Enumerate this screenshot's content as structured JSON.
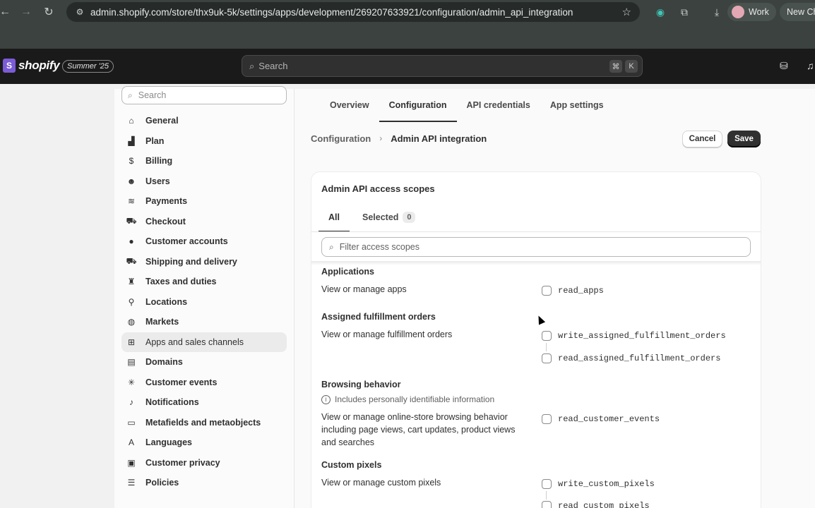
{
  "browser": {
    "url": "admin.shopify.com/store/thx9uk-5k/settings/apps/development/269207633921/configuration/admin_api_integration",
    "profile_label": "Work",
    "new_chrome_label": "New Ch"
  },
  "topbar": {
    "brand": "shopify",
    "badge": "Summer '25",
    "search_placeholder": "Search",
    "kbd_1": "⌘",
    "kbd_2": "K"
  },
  "sidebar": {
    "search_placeholder": "Search",
    "items": [
      {
        "label": "General",
        "icon": "store-icon"
      },
      {
        "label": "Plan",
        "icon": "plan-icon"
      },
      {
        "label": "Billing",
        "icon": "billing-icon"
      },
      {
        "label": "Users",
        "icon": "users-icon"
      },
      {
        "label": "Payments",
        "icon": "payments-icon"
      },
      {
        "label": "Checkout",
        "icon": "cart-icon"
      },
      {
        "label": "Customer accounts",
        "icon": "person-icon"
      },
      {
        "label": "Shipping and delivery",
        "icon": "truck-icon"
      },
      {
        "label": "Taxes and duties",
        "icon": "tax-icon"
      },
      {
        "label": "Locations",
        "icon": "location-icon"
      },
      {
        "label": "Markets",
        "icon": "globe-icon"
      },
      {
        "label": "Apps and sales channels",
        "icon": "apps-icon"
      },
      {
        "label": "Domains",
        "icon": "domains-icon"
      },
      {
        "label": "Customer events",
        "icon": "events-icon"
      },
      {
        "label": "Notifications",
        "icon": "bell-icon"
      },
      {
        "label": "Metafields and metaobjects",
        "icon": "metafields-icon"
      },
      {
        "label": "Languages",
        "icon": "languages-icon"
      },
      {
        "label": "Customer privacy",
        "icon": "lock-icon"
      },
      {
        "label": "Policies",
        "icon": "policies-icon"
      }
    ]
  },
  "tabs": [
    "Overview",
    "Configuration",
    "API credentials",
    "App settings"
  ],
  "breadcrumb": {
    "parent": "Configuration",
    "current": "Admin API integration"
  },
  "actions": {
    "cancel": "Cancel",
    "save": "Save"
  },
  "card": {
    "title": "Admin API access scopes",
    "tab_all": "All",
    "tab_selected": "Selected",
    "selected_count": "0",
    "filter_placeholder": "Filter access scopes"
  },
  "groups": [
    {
      "title": "Applications",
      "desc": "View or manage apps",
      "scopes": [
        "read_apps"
      ]
    },
    {
      "title": "Assigned fulfillment orders",
      "desc": "View or manage fulfillment orders",
      "scopes": [
        "write_assigned_fulfillment_orders",
        "read_assigned_fulfillment_orders"
      ]
    },
    {
      "title": "Browsing behavior",
      "note": "Includes personally identifiable information",
      "desc": "View or manage online-store browsing behavior including page views, cart updates, product views and searches",
      "scopes": [
        "read_customer_events"
      ]
    },
    {
      "title": "Custom pixels",
      "desc": "View or manage custom pixels",
      "scopes": [
        "write_custom_pixels",
        "read_custom_pixels"
      ]
    }
  ]
}
